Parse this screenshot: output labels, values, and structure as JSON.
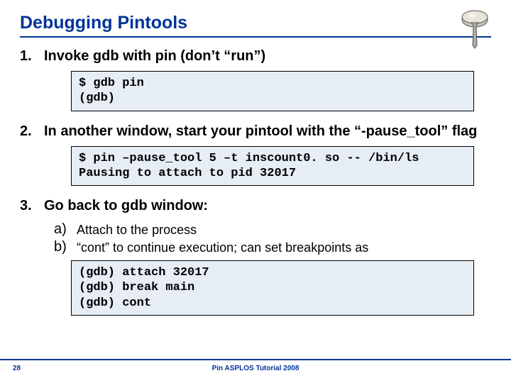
{
  "title": "Debugging Pintools",
  "steps": [
    {
      "num": "1.",
      "text": "Invoke gdb with pin (don’t “run”)",
      "code": "$ gdb pin\n(gdb)"
    },
    {
      "num": "2.",
      "text": "In another window, start your pintool with the “-pause_tool” flag",
      "code": "$ pin –pause_tool 5 –t inscount0. so -- /bin/ls\nPausing to attach to pid 32017"
    },
    {
      "num": "3.",
      "text": "Go back to gdb window:",
      "subs": [
        {
          "letter": "a)",
          "text": "Attach to the process"
        },
        {
          "letter": "b)",
          "text": "“cont” to continue execution; can set breakpoints as"
        }
      ],
      "code": "(gdb) attach 32017\n(gdb) break main\n(gdb) cont"
    }
  ],
  "footer": {
    "page": "28",
    "text": "Pin ASPLOS Tutorial 2008"
  },
  "icon": "pushpin-icon"
}
